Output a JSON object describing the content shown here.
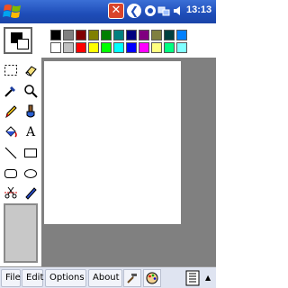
{
  "statusbar": {
    "close_label": "✕",
    "back_label": "❮",
    "clock": "13:13"
  },
  "palette": {
    "foreground": "#000000",
    "background": "#ffffff",
    "row1": [
      "#000000",
      "#808080",
      "#800000",
      "#808000",
      "#008000",
      "#008080",
      "#000080",
      "#800080",
      "#808040",
      "#004040",
      "#0080ff"
    ],
    "row2": [
      "#ffffff",
      "#c0c0c0",
      "#ff0000",
      "#ffff00",
      "#00ff00",
      "#00ffff",
      "#0000ff",
      "#ff00ff",
      "#ffff80",
      "#00ff80",
      "#80ffff"
    ]
  },
  "tools": [
    {
      "name": "select-rect-tool",
      "icon": "dashed-rectangle-icon"
    },
    {
      "name": "eraser-tool",
      "icon": "eraser-icon"
    },
    {
      "name": "eyedropper-tool",
      "icon": "eyedropper-icon"
    },
    {
      "name": "zoom-tool",
      "icon": "magnifier-icon"
    },
    {
      "name": "pencil-tool",
      "icon": "pencil-icon"
    },
    {
      "name": "brush-tool",
      "icon": "brush-icon"
    },
    {
      "name": "fill-tool",
      "icon": "paint-bucket-icon"
    },
    {
      "name": "text-tool",
      "icon": "text-a-icon",
      "glyph": "A"
    },
    {
      "name": "line-tool",
      "icon": "line-icon"
    },
    {
      "name": "rectangle-tool",
      "icon": "rectangle-icon"
    },
    {
      "name": "rounded-rect-tool",
      "icon": "rounded-rectangle-icon"
    },
    {
      "name": "ellipse-tool",
      "icon": "ellipse-icon"
    },
    {
      "name": "cut-tool",
      "icon": "scissors-icon"
    },
    {
      "name": "pen-tool",
      "icon": "pen-icon"
    }
  ],
  "menu": {
    "file": "File",
    "edit": "Edit",
    "options": "Options",
    "about": "About"
  }
}
